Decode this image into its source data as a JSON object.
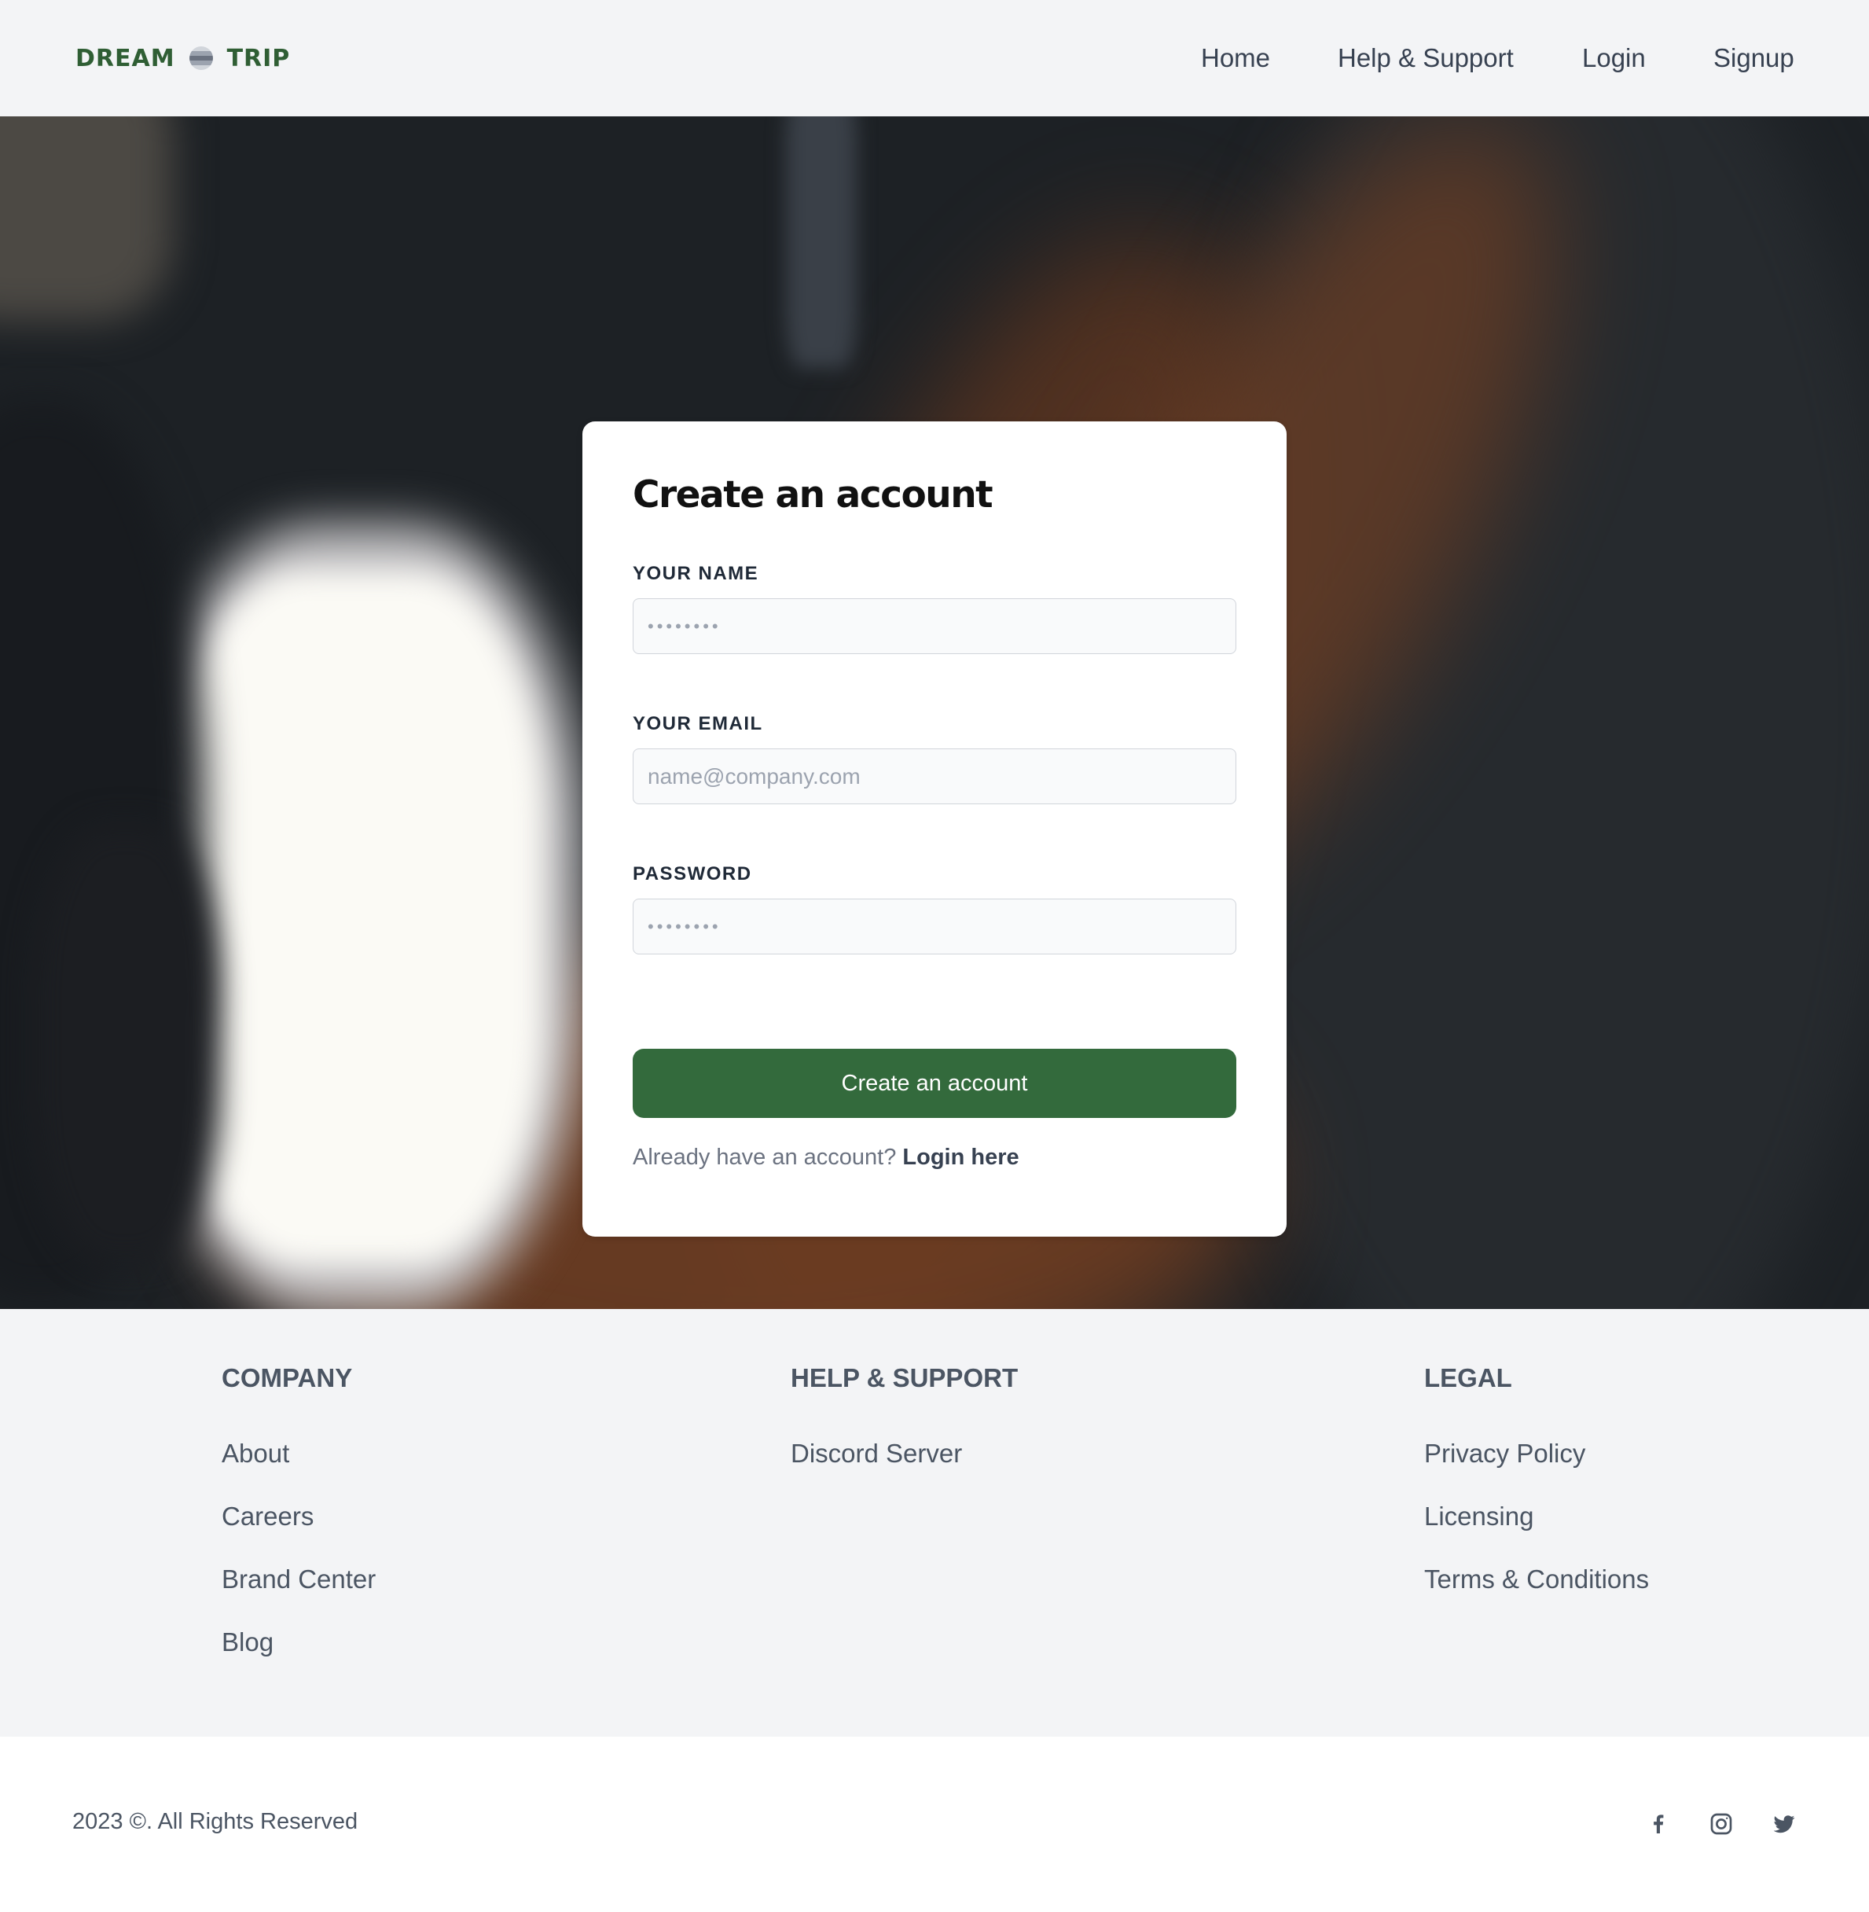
{
  "brand": {
    "left": "DREAM",
    "right": "TRIP"
  },
  "nav": {
    "items": [
      {
        "label": "Home"
      },
      {
        "label": "Help & Support"
      },
      {
        "label": "Login"
      },
      {
        "label": "Signup"
      }
    ]
  },
  "form": {
    "title": "Create an account",
    "name_label": "YOUR NAME",
    "name_placeholder": "••••••••",
    "email_label": "YOUR EMAIL",
    "email_placeholder": "name@company.com",
    "password_label": "PASSWORD",
    "password_placeholder": "••••••••",
    "submit_label": "Create an account",
    "login_prompt": "Already have an account?",
    "login_link": "Login here"
  },
  "footer": {
    "columns": [
      {
        "title": "COMPANY",
        "links": [
          "About",
          "Careers",
          "Brand Center",
          "Blog"
        ]
      },
      {
        "title": "HELP & SUPPORT",
        "links": [
          "Discord Server"
        ]
      },
      {
        "title": "LEGAL",
        "links": [
          "Privacy Policy",
          "Licensing",
          "Terms & Conditions"
        ]
      }
    ],
    "copyright": "2023 ©. All Rights Reserved",
    "social": [
      {
        "icon": "facebook-icon"
      },
      {
        "icon": "instagram-icon"
      },
      {
        "icon": "twitter-icon"
      }
    ]
  },
  "colors": {
    "brand_green": "#2f5e34",
    "button_green": "#336a3c",
    "header_bg": "#f3f4f6"
  }
}
